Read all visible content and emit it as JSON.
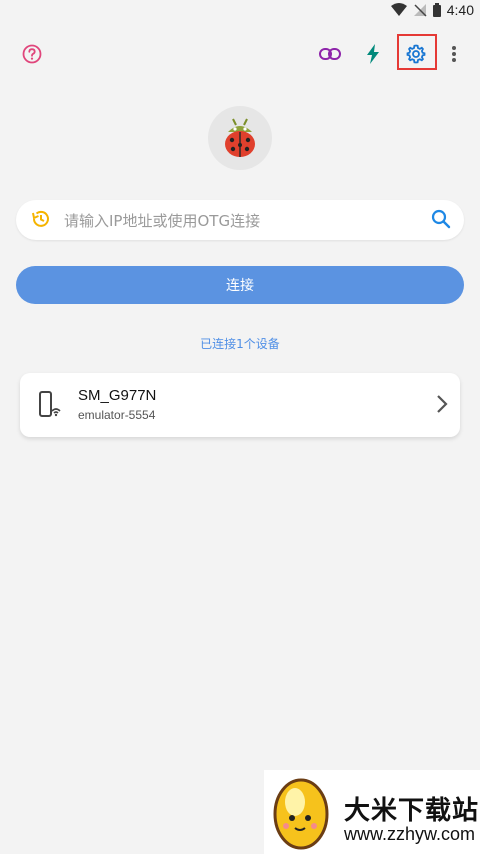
{
  "status": {
    "time": "4:40"
  },
  "toolbar": {
    "help_icon": "help-circle-icon",
    "link_icon": "link-icon",
    "flash_icon": "bolt-icon",
    "settings_icon": "gear-icon",
    "more_icon": "more-vertical-icon"
  },
  "search": {
    "placeholder": "请输入IP地址或使用OTG连接",
    "value": ""
  },
  "connect_button": {
    "label": "连接"
  },
  "connected_text": "已连接1个设备",
  "devices": [
    {
      "name": "SM_G977N",
      "subtitle": "emulator-5554"
    }
  ],
  "watermark": {
    "title": "大米下载站",
    "url": "www.zzhyw.com"
  },
  "colors": {
    "accent": "#5b93e1",
    "link": "#4f8fe6",
    "highlight": "#e53935",
    "help": "#e0457b",
    "link_icon": "#8e24aa",
    "flash_icon": "#00897b",
    "settings_icon": "#1976d2"
  }
}
